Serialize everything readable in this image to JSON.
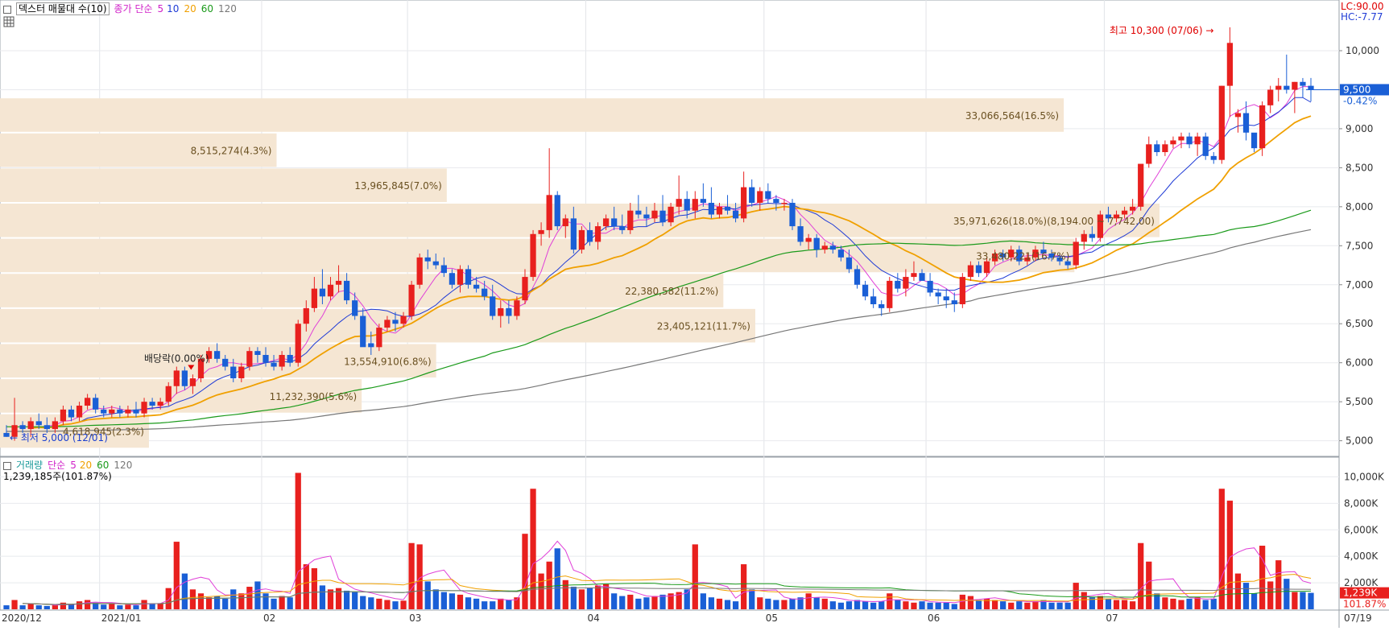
{
  "header": {
    "title": "덱스터 매물대 수(10)",
    "ma_label": "종가 단순",
    "ma5": "5",
    "ma10": "10",
    "ma20": "20",
    "ma60": "60",
    "ma120": "120",
    "lc": "LC:90.00",
    "hc": "HC:-7.77"
  },
  "volume_header": {
    "label": "거래량",
    "ma_label": "단순",
    "ma5": "5",
    "ma20": "20",
    "ma60": "60",
    "ma120": "120",
    "current": "1,239,185주(101.87%)"
  },
  "chart_data": {
    "type": "candlestick",
    "price_axis": {
      "range": [
        4800,
        10650
      ],
      "ticks": [
        "5,000",
        "5,500",
        "6,000",
        "6,500",
        "7,000",
        "7,500",
        "8,000",
        "8,500",
        "9,000",
        "9,500",
        "10,000"
      ],
      "tick_values": [
        5000,
        5500,
        6000,
        6500,
        7000,
        7500,
        8000,
        8500,
        9000,
        9500,
        10000
      ]
    },
    "volume_axis": {
      "range": [
        0,
        11000000
      ],
      "ticks": [
        "2,000K",
        "4,000K",
        "6,000K",
        "8,000K",
        "10,000K"
      ],
      "tick_values": [
        2000000,
        4000000,
        6000000,
        8000000,
        10000000
      ]
    },
    "date_labels": [
      "2020/12",
      "2021/01",
      "02",
      "03",
      "04",
      "05",
      "06",
      "07",
      "07/19"
    ],
    "date_label_index": [
      0,
      12,
      32,
      50,
      72,
      94,
      114,
      136,
      158
    ],
    "current_price": {
      "value": 9500,
      "label": "9,500",
      "change": "-0.42%"
    },
    "current_volume": {
      "label": "1,239K",
      "pct": "101.87%"
    },
    "annotations": {
      "high": "최고 10,300 (07/06)",
      "low": "최저 5,000 (12/01)",
      "dividend": "배당락(0.00%)"
    },
    "volume_profile": [
      {
        "low": 8950,
        "high": 9400,
        "label": "33,066,564(16.5%)",
        "rel": 1.0
      },
      {
        "low": 8500,
        "high": 8950,
        "label": "8,515,274(4.3%)",
        "rel": 0.26
      },
      {
        "low": 8050,
        "high": 8500,
        "label": "13,965,845(7.0%)",
        "rel": 0.42
      },
      {
        "low": 7600,
        "high": 8050,
        "label": "35,971,626(18.0%)(8,194.00 ~ 7,742.00)",
        "rel": 1.09
      },
      {
        "low": 7150,
        "high": 7600,
        "label": "33,480,221(16.7%)",
        "rel": 1.01
      },
      {
        "low": 6700,
        "high": 7150,
        "label": "22,380,582(11.2%)",
        "rel": 0.68
      },
      {
        "low": 6250,
        "high": 6700,
        "label": "23,405,121(11.7%)",
        "rel": 0.71
      },
      {
        "low": 5800,
        "high": 6250,
        "label": "13,554,910(6.8%)",
        "rel": 0.41
      },
      {
        "low": 5350,
        "high": 5800,
        "label": "11,232,390(5.6%)",
        "rel": 0.34
      },
      {
        "low": 4900,
        "high": 5350,
        "label": "4,618,945(2.3%)",
        "rel": 0.14
      }
    ],
    "candles": [
      [
        5100,
        5200,
        5050,
        5050,
        300000
      ],
      [
        5050,
        5550,
        5000,
        5200,
        700000
      ],
      [
        5200,
        5250,
        5100,
        5150,
        300000
      ],
      [
        5150,
        5300,
        5050,
        5250,
        400000
      ],
      [
        5250,
        5350,
        5150,
        5200,
        300000
      ],
      [
        5200,
        5300,
        5100,
        5150,
        250000
      ],
      [
        5150,
        5300,
        5100,
        5250,
        300000
      ],
      [
        5250,
        5450,
        5200,
        5400,
        500000
      ],
      [
        5400,
        5450,
        5250,
        5300,
        400000
      ],
      [
        5300,
        5500,
        5250,
        5450,
        600000
      ],
      [
        5450,
        5600,
        5400,
        5550,
        700000
      ],
      [
        5550,
        5600,
        5350,
        5400,
        500000
      ],
      [
        5400,
        5450,
        5300,
        5350,
        350000
      ],
      [
        5350,
        5450,
        5300,
        5400,
        400000
      ],
      [
        5400,
        5450,
        5300,
        5350,
        300000
      ],
      [
        5350,
        5450,
        5300,
        5400,
        350000
      ],
      [
        5400,
        5500,
        5300,
        5350,
        300000
      ],
      [
        5350,
        5550,
        5300,
        5500,
        700000
      ],
      [
        5500,
        5550,
        5400,
        5450,
        400000
      ],
      [
        5450,
        5550,
        5400,
        5500,
        450000
      ],
      [
        5500,
        5750,
        5450,
        5700,
        1600000
      ],
      [
        5700,
        5950,
        5600,
        5900,
        5100000
      ],
      [
        5900,
        5950,
        5650,
        5700,
        2700000
      ],
      [
        5700,
        5850,
        5600,
        5800,
        1500000
      ],
      [
        5800,
        6100,
        5750,
        6050,
        1200000
      ],
      [
        6050,
        6200,
        6000,
        6150,
        900000
      ],
      [
        6150,
        6250,
        6000,
        6050,
        1000000
      ],
      [
        6050,
        6100,
        5900,
        5950,
        800000
      ],
      [
        5950,
        6050,
        5750,
        5800,
        1500000
      ],
      [
        5800,
        6000,
        5750,
        5950,
        1200000
      ],
      [
        5950,
        6200,
        5900,
        6150,
        1700000
      ],
      [
        6150,
        6200,
        6000,
        6100,
        2100000
      ],
      [
        6100,
        6200,
        5950,
        6000,
        1200000
      ],
      [
        6000,
        6100,
        5900,
        5950,
        800000
      ],
      [
        5950,
        6150,
        5900,
        6100,
        1000000
      ],
      [
        6100,
        6200,
        5950,
        6000,
        900000
      ],
      [
        6000,
        6550,
        5950,
        6500,
        10300000
      ],
      [
        6500,
        6800,
        6400,
        6700,
        3400000
      ],
      [
        6700,
        7100,
        6650,
        6950,
        3100000
      ],
      [
        6950,
        7200,
        6750,
        6850,
        1800000
      ],
      [
        6850,
        7100,
        6800,
        7000,
        1500000
      ],
      [
        7000,
        7250,
        6900,
        7050,
        1600000
      ],
      [
        7050,
        7150,
        6750,
        6800,
        1400000
      ],
      [
        6800,
        6900,
        6550,
        6600,
        1300000
      ],
      [
        6600,
        6700,
        6250,
        6200,
        1000000
      ],
      [
        6250,
        6400,
        6100,
        6200,
        900000
      ],
      [
        6200,
        6500,
        6150,
        6450,
        800000
      ],
      [
        6450,
        6600,
        6400,
        6550,
        700000
      ],
      [
        6550,
        6650,
        6400,
        6500,
        600000
      ],
      [
        6500,
        6650,
        6450,
        6600,
        650000
      ],
      [
        6600,
        7050,
        6550,
        7000,
        5000000
      ],
      [
        7000,
        7400,
        6950,
        7350,
        4900000
      ],
      [
        7350,
        7450,
        7200,
        7300,
        2100000
      ],
      [
        7300,
        7400,
        7200,
        7250,
        1500000
      ],
      [
        7250,
        7350,
        7100,
        7150,
        1300000
      ],
      [
        7150,
        7200,
        6950,
        7000,
        1200000
      ],
      [
        7000,
        7250,
        6900,
        7200,
        1100000
      ],
      [
        7200,
        7250,
        6950,
        7000,
        900000
      ],
      [
        7000,
        7100,
        6900,
        6950,
        800000
      ],
      [
        6950,
        7050,
        6800,
        6850,
        600000
      ],
      [
        6850,
        7000,
        6550,
        6600,
        600000
      ],
      [
        6600,
        6800,
        6450,
        6700,
        800000
      ],
      [
        6700,
        6800,
        6500,
        6600,
        700000
      ],
      [
        6600,
        6850,
        6550,
        6800,
        900000
      ],
      [
        6800,
        7200,
        6750,
        7100,
        5700000
      ],
      [
        7100,
        7700,
        7050,
        7650,
        9100000
      ],
      [
        7650,
        7800,
        7500,
        7700,
        2700000
      ],
      [
        7700,
        8750,
        7600,
        8150,
        3600000
      ],
      [
        8150,
        8200,
        7700,
        7750,
        4600000
      ],
      [
        7750,
        7900,
        7600,
        7850,
        2200000
      ],
      [
        7850,
        8000,
        7400,
        7450,
        1700000
      ],
      [
        7450,
        7750,
        7400,
        7700,
        1500000
      ],
      [
        7700,
        7800,
        7500,
        7550,
        1600000
      ],
      [
        7550,
        7800,
        7450,
        7750,
        1800000
      ],
      [
        7750,
        7900,
        7700,
        7850,
        1900000
      ],
      [
        7850,
        8000,
        7700,
        7750,
        1200000
      ],
      [
        7750,
        7900,
        7650,
        7700,
        1000000
      ],
      [
        7700,
        8050,
        7650,
        7950,
        1100000
      ],
      [
        7950,
        8150,
        7850,
        7900,
        800000
      ],
      [
        7900,
        8000,
        7750,
        7850,
        900000
      ],
      [
        7850,
        8050,
        7800,
        7950,
        1000000
      ],
      [
        7950,
        8150,
        7750,
        7800,
        1100000
      ],
      [
        7800,
        8050,
        7750,
        8000,
        1200000
      ],
      [
        8000,
        8400,
        7900,
        8100,
        1300000
      ],
      [
        8100,
        8200,
        7850,
        7950,
        1500000
      ],
      [
        7950,
        8200,
        7850,
        8100,
        4900000
      ],
      [
        8100,
        8300,
        8000,
        8050,
        1200000
      ],
      [
        8050,
        8250,
        7850,
        7900,
        900000
      ],
      [
        7900,
        8050,
        7850,
        8000,
        800000
      ],
      [
        8000,
        8150,
        7900,
        7950,
        700000
      ],
      [
        7950,
        8050,
        7800,
        7850,
        600000
      ],
      [
        7850,
        8450,
        7800,
        8250,
        3400000
      ],
      [
        8250,
        8350,
        8000,
        8050,
        1500000
      ],
      [
        8050,
        8250,
        7950,
        8200,
        900000
      ],
      [
        8200,
        8300,
        8050,
        8100,
        800000
      ],
      [
        8100,
        8150,
        7950,
        8050,
        700000
      ],
      [
        8050,
        8100,
        7950,
        8050,
        700000
      ],
      [
        8050,
        8100,
        7700,
        7750,
        800000
      ],
      [
        7750,
        7850,
        7500,
        7550,
        900000
      ],
      [
        7550,
        7650,
        7450,
        7600,
        1200000
      ],
      [
        7600,
        7650,
        7350,
        7450,
        900000
      ],
      [
        7450,
        7550,
        7400,
        7500,
        800000
      ],
      [
        7500,
        7550,
        7400,
        7450,
        600000
      ],
      [
        7450,
        7500,
        7300,
        7350,
        500000
      ],
      [
        7350,
        7450,
        7150,
        7200,
        600000
      ],
      [
        7200,
        7250,
        6950,
        7000,
        700000
      ],
      [
        7000,
        7050,
        6800,
        6850,
        600000
      ],
      [
        6850,
        6950,
        6700,
        6750,
        500000
      ],
      [
        6750,
        6800,
        6600,
        6700,
        600000
      ],
      [
        6700,
        7100,
        6650,
        7050,
        1200000
      ],
      [
        7050,
        7150,
        6900,
        6950,
        700000
      ],
      [
        6950,
        7200,
        6850,
        7100,
        600000
      ],
      [
        7100,
        7300,
        7050,
        7150,
        500000
      ],
      [
        7150,
        7200,
        7050,
        7050,
        600000
      ],
      [
        7050,
        7150,
        6850,
        6900,
        500000
      ],
      [
        6900,
        6950,
        6750,
        6850,
        500000
      ],
      [
        6850,
        6950,
        6700,
        6800,
        500000
      ],
      [
        6800,
        6900,
        6650,
        6750,
        400000
      ],
      [
        6750,
        7150,
        6700,
        7100,
        1100000
      ],
      [
        7100,
        7300,
        7050,
        7250,
        1000000
      ],
      [
        7250,
        7300,
        7100,
        7150,
        700000
      ],
      [
        7150,
        7350,
        7100,
        7300,
        800000
      ],
      [
        7300,
        7450,
        7250,
        7400,
        700000
      ],
      [
        7400,
        7450,
        7300,
        7350,
        600000
      ],
      [
        7350,
        7500,
        7300,
        7450,
        500000
      ],
      [
        7450,
        7500,
        7250,
        7300,
        600000
      ],
      [
        7300,
        7400,
        7250,
        7350,
        500000
      ],
      [
        7350,
        7500,
        7300,
        7450,
        600000
      ],
      [
        7450,
        7550,
        7400,
        7400,
        700000
      ],
      [
        7400,
        7450,
        7300,
        7350,
        500000
      ],
      [
        7350,
        7400,
        7250,
        7300,
        500000
      ],
      [
        7300,
        7350,
        7200,
        7250,
        500000
      ],
      [
        7250,
        7600,
        7200,
        7550,
        2000000
      ],
      [
        7550,
        7700,
        7450,
        7650,
        1300000
      ],
      [
        7650,
        7750,
        7550,
        7600,
        900000
      ],
      [
        7600,
        7950,
        7550,
        7900,
        1000000
      ],
      [
        7900,
        8000,
        7800,
        7850,
        800000
      ],
      [
        7850,
        7950,
        7800,
        7900,
        700000
      ],
      [
        7900,
        8000,
        7850,
        7950,
        700000
      ],
      [
        7950,
        8100,
        7900,
        8000,
        600000
      ],
      [
        8000,
        8500,
        7950,
        8550,
        5000000
      ],
      [
        8550,
        8900,
        8500,
        8800,
        3600000
      ],
      [
        8800,
        8850,
        8650,
        8700,
        1200000
      ],
      [
        8700,
        8850,
        8650,
        8800,
        900000
      ],
      [
        8800,
        8900,
        8750,
        8850,
        800000
      ],
      [
        8850,
        8950,
        8750,
        8900,
        700000
      ],
      [
        8900,
        8950,
        8750,
        8800,
        800000
      ],
      [
        8800,
        8950,
        8650,
        8900,
        900000
      ],
      [
        8900,
        8950,
        8600,
        8650,
        700000
      ],
      [
        8650,
        8700,
        8550,
        8600,
        800000
      ],
      [
        8600,
        9550,
        8550,
        9550,
        9100000
      ],
      [
        9550,
        10300,
        9150,
        10100,
        8200000
      ],
      [
        9150,
        9250,
        8950,
        9200,
        2700000
      ],
      [
        9200,
        9350,
        8850,
        8950,
        2000000
      ],
      [
        8950,
        8900,
        8700,
        8750,
        1200000
      ],
      [
        8750,
        9350,
        8650,
        9300,
        4800000
      ],
      [
        9300,
        9550,
        9200,
        9500,
        2100000
      ],
      [
        9500,
        9650,
        9350,
        9550,
        3700000
      ],
      [
        9550,
        9950,
        9450,
        9500,
        2300000
      ],
      [
        9500,
        9600,
        9200,
        9600,
        1300000
      ],
      [
        9600,
        9650,
        9400,
        9550,
        1300000
      ],
      [
        9550,
        9650,
        9350,
        9500,
        1239185
      ]
    ]
  }
}
